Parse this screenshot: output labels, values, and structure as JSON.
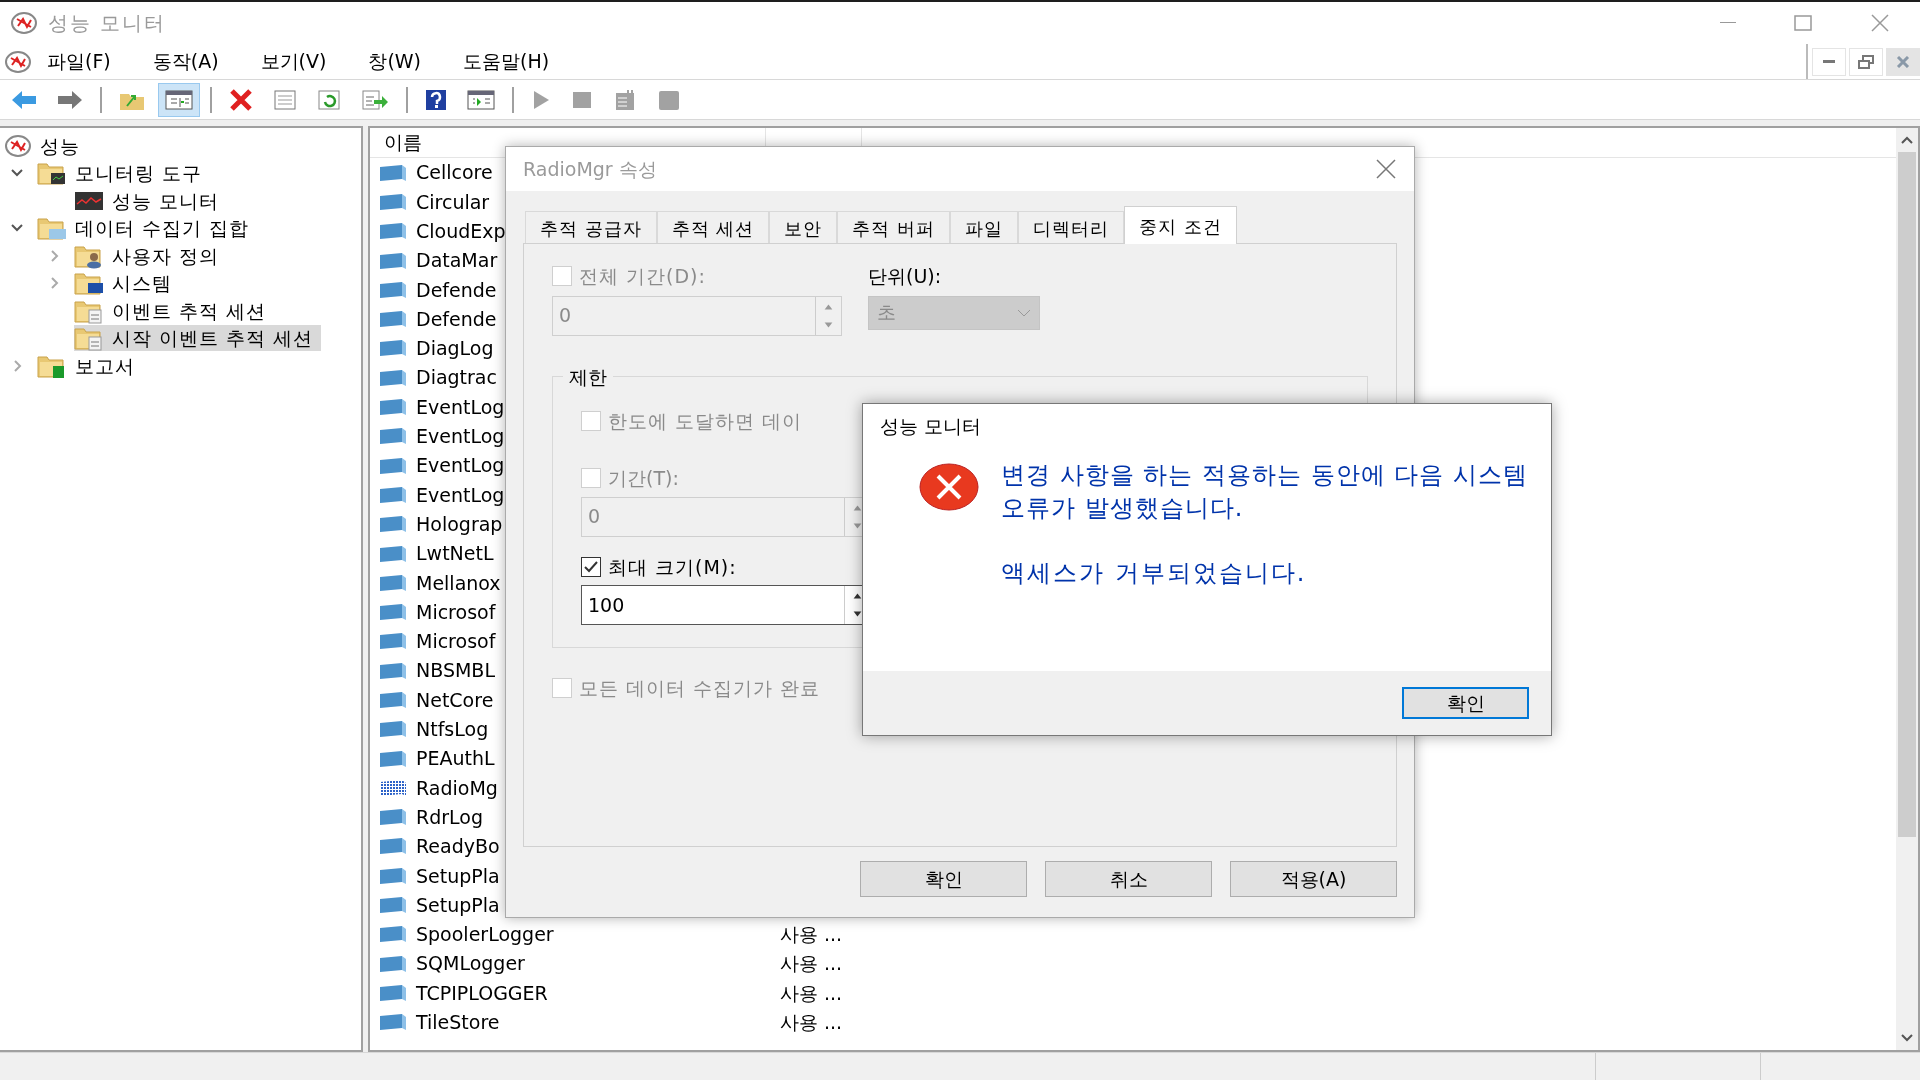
{
  "window": {
    "title": "성능 모니터"
  },
  "menu": [
    "파일(F)",
    "동작(A)",
    "보기(V)",
    "창(W)",
    "도움말(H)"
  ],
  "toolbar": [
    {
      "kind": "back",
      "pressed": false,
      "disabled": false
    },
    {
      "kind": "forward",
      "pressed": false,
      "disabled": false
    },
    {
      "kind": "sep"
    },
    {
      "kind": "up",
      "pressed": false,
      "disabled": false
    },
    {
      "kind": "tree",
      "pressed": true,
      "disabled": false
    },
    {
      "kind": "sep"
    },
    {
      "kind": "delete",
      "pressed": false,
      "disabled": false
    },
    {
      "kind": "props",
      "pressed": false,
      "disabled": false
    },
    {
      "kind": "refresh",
      "pressed": false,
      "disabled": false
    },
    {
      "kind": "export",
      "pressed": false,
      "disabled": false
    },
    {
      "kind": "sep"
    },
    {
      "kind": "help",
      "pressed": false,
      "disabled": false
    },
    {
      "kind": "view",
      "pressed": false,
      "disabled": false
    },
    {
      "kind": "sep"
    },
    {
      "kind": "play",
      "pressed": false,
      "disabled": true
    },
    {
      "kind": "stop",
      "pressed": false,
      "disabled": true
    },
    {
      "kind": "note",
      "pressed": false,
      "disabled": true
    },
    {
      "kind": "block",
      "pressed": false,
      "disabled": true
    }
  ],
  "tree": [
    {
      "label": "성능",
      "kind": "perf",
      "selected": false,
      "children": [
        {
          "label": "모니터링 도구",
          "kind": "tools",
          "expanded": true,
          "selected": false,
          "children": [
            {
              "label": "성능 모니터",
              "kind": "monitor",
              "selected": false
            }
          ]
        },
        {
          "label": "데이터 수집기 집합",
          "kind": "sets",
          "expanded": true,
          "selected": false,
          "children": [
            {
              "label": "사용자 정의",
              "kind": "user",
              "expanded": false,
              "selected": false
            },
            {
              "label": "시스템",
              "kind": "system",
              "expanded": false,
              "selected": false
            },
            {
              "label": "이벤트 추적 세션",
              "kind": "session",
              "selected": false
            },
            {
              "label": "시작 이벤트 추적 세션",
              "kind": "session",
              "selected": true
            }
          ]
        },
        {
          "label": "보고서",
          "kind": "reports",
          "expanded": false,
          "selected": false
        }
      ]
    }
  ],
  "table": {
    "columns": [
      "이름"
    ],
    "rows": [
      {
        "name": "Cellcore",
        "selected": false
      },
      {
        "name": "Circular",
        "selected": false
      },
      {
        "name": "CloudExp",
        "selected": false
      },
      {
        "name": "DataMar",
        "selected": false
      },
      {
        "name": "Defende",
        "selected": false
      },
      {
        "name": "Defende",
        "selected": false
      },
      {
        "name": "DiagLog",
        "selected": false
      },
      {
        "name": "Diagtrac",
        "selected": false
      },
      {
        "name": "EventLog",
        "selected": false
      },
      {
        "name": "EventLog",
        "selected": false
      },
      {
        "name": "EventLog",
        "selected": false
      },
      {
        "name": "EventLog",
        "selected": false
      },
      {
        "name": "Holograp",
        "selected": false
      },
      {
        "name": "LwtNetL",
        "selected": false
      },
      {
        "name": "Mellanox",
        "selected": false
      },
      {
        "name": "Microsof",
        "selected": false
      },
      {
        "name": "Microsof",
        "selected": false
      },
      {
        "name": "NBSMBL",
        "selected": false
      },
      {
        "name": "NetCore",
        "selected": false
      },
      {
        "name": "NtfsLog",
        "selected": false
      },
      {
        "name": "PEAuthL",
        "selected": false
      },
      {
        "name": "RadioMg",
        "selected": true
      },
      {
        "name": "RdrLog",
        "selected": false
      },
      {
        "name": "ReadyBo",
        "selected": false
      },
      {
        "name": "SetupPla",
        "selected": false
      },
      {
        "name": "SetupPla",
        "selected": false
      },
      {
        "name": "SpoolerLogger",
        "status": "사용 ...",
        "selected": false
      },
      {
        "name": "SQMLogger",
        "status": "사용 ...",
        "selected": false
      },
      {
        "name": "TCPIPLOGGER",
        "status": "사용 ...",
        "selected": false
      },
      {
        "name": "TileStore",
        "status": "사용 ...",
        "selected": false
      }
    ]
  },
  "properties_dialog": {
    "title": "RadioMgr 속성",
    "tabs": [
      {
        "label": "추적 공급자",
        "selected": false
      },
      {
        "label": "추적 세션",
        "selected": false
      },
      {
        "label": "보안",
        "selected": false
      },
      {
        "label": "추적 버퍼",
        "selected": false
      },
      {
        "label": "파일",
        "selected": false
      },
      {
        "label": "디렉터리",
        "selected": false
      },
      {
        "label": "중지 조건",
        "selected": true
      }
    ],
    "overall_duration": {
      "label": "전체 기간(D):",
      "checked": false,
      "value": "0"
    },
    "units": {
      "label": "단위(U):",
      "value": "초",
      "disabled": true
    },
    "limits": {
      "title": "제한",
      "restart": {
        "label": "한도에 도달하면 데이",
        "checked": false
      },
      "duration": {
        "label": "기간(T):",
        "checked": false,
        "value": "0",
        "disabled": true
      },
      "max_size": {
        "label": "최대 크기(M):",
        "checked": true,
        "value": "100",
        "disabled": false
      }
    },
    "stop_when_done": {
      "label": "모든 데이터 수집기가 완료",
      "checked": false
    },
    "buttons": [
      "확인",
      "취소",
      "적용(A)"
    ]
  },
  "error_dialog": {
    "title": "성능 모니터",
    "message": "변경 사항을 하는 적용하는 동안에 다음 시스템 오류가 발생했습니다.",
    "detail": "액세스가 거부되었습니다.",
    "button": "확인"
  }
}
